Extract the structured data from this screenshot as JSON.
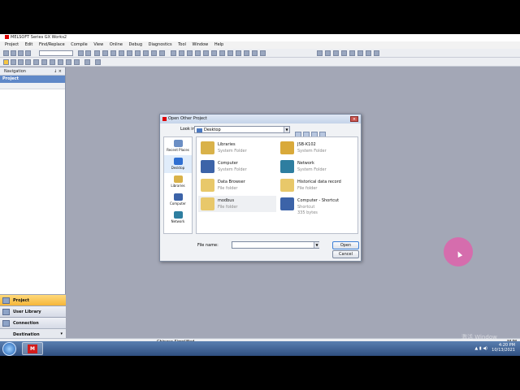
{
  "app": {
    "title": "MELSOFT Series GX Works2"
  },
  "menu": [
    "Project",
    "Edit",
    "Find/Replace",
    "Compile",
    "View",
    "Online",
    "Debug",
    "Diagnostics",
    "Tool",
    "Window",
    "Help"
  ],
  "navigation": {
    "title": "Navigation",
    "controls": "↓ ×",
    "section": "Project",
    "tabs": [
      {
        "label": "Project",
        "active": true
      },
      {
        "label": "User Library",
        "active": false
      },
      {
        "label": "Connection Destination",
        "active": false
      }
    ]
  },
  "status": {
    "language": "Chinese Simplified",
    "num": "NUM"
  },
  "watermark": "激活 Window",
  "dialog": {
    "title": "Open Other Project",
    "close_label": "×",
    "lookin_label": "Look in:",
    "lookin_value": "Desktop",
    "places": [
      {
        "label": "Recent Places",
        "icon": "recent-places-icon",
        "color": "#6c8fc4"
      },
      {
        "label": "Desktop",
        "icon": "desktop-icon",
        "color": "#2f6fd1",
        "selected": true
      },
      {
        "label": "Libraries",
        "icon": "libraries-icon",
        "color": "#d9b24a"
      },
      {
        "label": "Computer",
        "icon": "computer-icon",
        "color": "#3c63a8"
      },
      {
        "label": "Network",
        "icon": "network-icon",
        "color": "#2e7ea0"
      }
    ],
    "files": [
      {
        "name": "Libraries",
        "type": "System Folder",
        "icon": "libraries-icon",
        "color": "#d9b24a"
      },
      {
        "name": "JSB-K102",
        "type": "System Folder",
        "icon": "user-folder-icon",
        "color": "#d9a93a"
      },
      {
        "name": "Computer",
        "type": "System Folder",
        "icon": "computer-icon",
        "color": "#3c63a8"
      },
      {
        "name": "Network",
        "type": "System Folder",
        "icon": "network-icon",
        "color": "#2e7ea0"
      },
      {
        "name": "Data Browser",
        "type": "File folder",
        "icon": "folder-icon",
        "color": "#e8c86a"
      },
      {
        "name": "Historical data record",
        "type": "File folder",
        "icon": "folder-icon",
        "color": "#e8c86a"
      },
      {
        "name": "modbus",
        "type": "File folder",
        "icon": "folder-icon",
        "color": "#e8c86a",
        "selected": true
      },
      {
        "name": "Computer - Shortcut",
        "type": "Shortcut",
        "extra": "335 bytes",
        "icon": "computer-shortcut-icon",
        "color": "#3c63a8"
      }
    ],
    "filename_label": "File name:",
    "filename_value": "",
    "open_label": "Open",
    "cancel_label": "Cancel"
  },
  "taskbar": {
    "time": "4:20 PM",
    "date": "10/13/2021",
    "app_glyph": "M"
  }
}
